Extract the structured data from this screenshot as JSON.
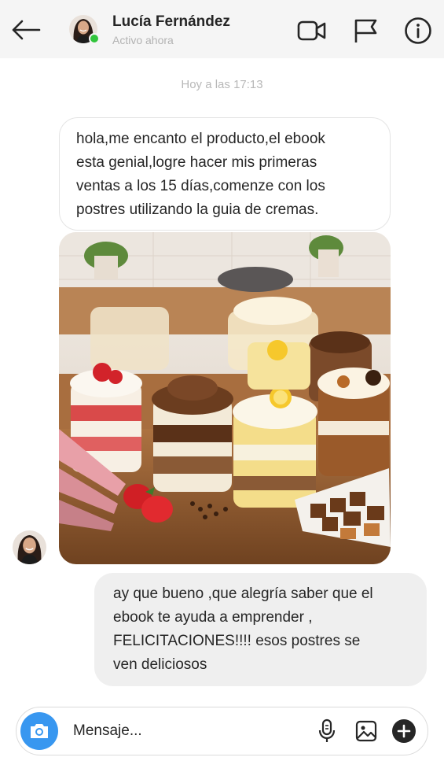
{
  "header": {
    "contact_name": "Lucía Fernández",
    "status": "Activo ahora",
    "back_icon": "arrow-left-icon",
    "video_icon": "video-camera-icon",
    "flag_icon": "flag-icon",
    "info_icon": "info-icon"
  },
  "conversation": {
    "timestamp": "Hoy a las 17:13",
    "messages": [
      {
        "sender": "contact",
        "type": "text",
        "lines": [
          "hola,me encanto el producto,el ebook",
          "esta genial,logre hacer mis primeras",
          "ventas a los 15 días,comenze con los",
          "postres utilizando la guia de cremas."
        ]
      },
      {
        "sender": "contact",
        "type": "image",
        "image_name": "dessert-cups-photo"
      },
      {
        "sender": "me",
        "type": "text",
        "lines": [
          "ay que bueno ,que alegría saber que el",
          "ebook te ayuda a emprender ,",
          "FELICITACIONES!!!! esos postres se",
          "ven deliciosos"
        ]
      }
    ]
  },
  "composer": {
    "placeholder": "Mensaje...",
    "value": "",
    "camera_icon": "camera-icon",
    "mic_icon": "microphone-icon",
    "gallery_icon": "image-gallery-icon",
    "plus_icon": "plus-circle-icon"
  },
  "colors": {
    "header_bg": "#f5f5f5",
    "accent_blue": "#3897f0",
    "online_green": "#31c43b",
    "outgoing_bubble": "#efefef",
    "incoming_border": "#e4e4e4"
  }
}
